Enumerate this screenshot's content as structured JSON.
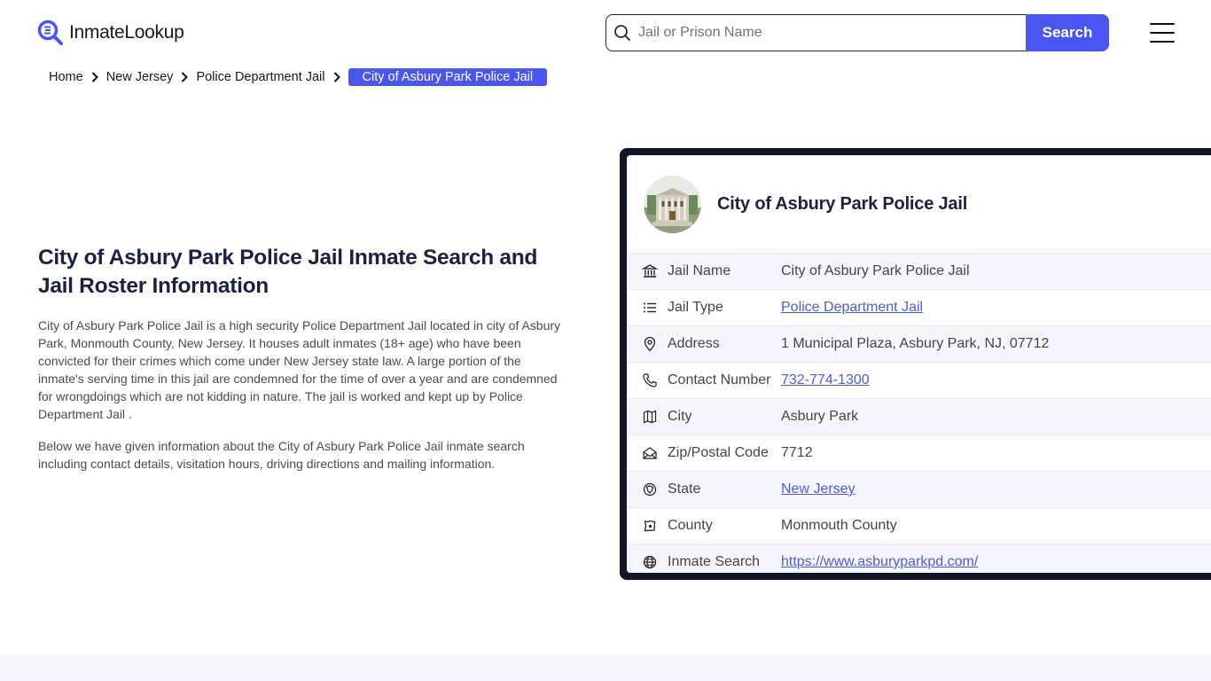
{
  "header": {
    "logo_text": "InmateLookup",
    "search_placeholder": "Jail or Prison Name",
    "search_value": "",
    "search_button": "Search",
    "brand_color": "#4a55f0"
  },
  "breadcrumb": {
    "items": [
      "Home",
      "New Jersey",
      "Police Department Jail"
    ],
    "active": "City of Asbury Park Police Jail"
  },
  "intro": {
    "title": "City of Asbury Park Police Jail Inmate Search and Jail Roster Information",
    "paragraph1": "City of Asbury Park Police Jail is a high security Police Department Jail located in city of Asbury Park, Monmouth County, New Jersey. It houses adult inmates (18+ age) who have been convicted for their crimes which come under New Jersey state law. A large portion of the inmate's serving time in this jail are condemned for the time of over a year and are condemned for wrongdoings which are not kidding in nature. The jail is worked and kept up by Police Department Jail .",
    "paragraph2": "Below we have given information about the City of Asbury Park Police Jail inmate search including contact details, visitation hours, driving directions and mailing information."
  },
  "card": {
    "title": "City of Asbury Park Police Jail",
    "rows": [
      {
        "icon": "building-columns-icon",
        "label": "Jail Name",
        "value": "City of Asbury Park Police Jail",
        "link": false
      },
      {
        "icon": "list-icon",
        "label": "Jail Type",
        "value": "Police Department Jail",
        "link": true
      },
      {
        "icon": "map-pin-icon",
        "label": "Address",
        "value": "1 Municipal Plaza, Asbury Park, NJ, 07712",
        "link": false
      },
      {
        "icon": "phone-icon",
        "label": "Contact Number",
        "value": "732-774-1300",
        "link": true
      },
      {
        "icon": "map-icon",
        "label": "City",
        "value": "Asbury Park",
        "link": false
      },
      {
        "icon": "mail-open-icon",
        "label": "Zip/Postal Code",
        "value": "7712",
        "link": false
      },
      {
        "icon": "state-badge-icon",
        "label": "State",
        "value": "New Jersey",
        "link": true
      },
      {
        "icon": "county-map-icon",
        "label": "County",
        "value": "Monmouth County",
        "link": false
      },
      {
        "icon": "globe-icon",
        "label": "Inmate Search",
        "value": "https://www.asburyparkpd.com/",
        "link": true
      }
    ]
  }
}
